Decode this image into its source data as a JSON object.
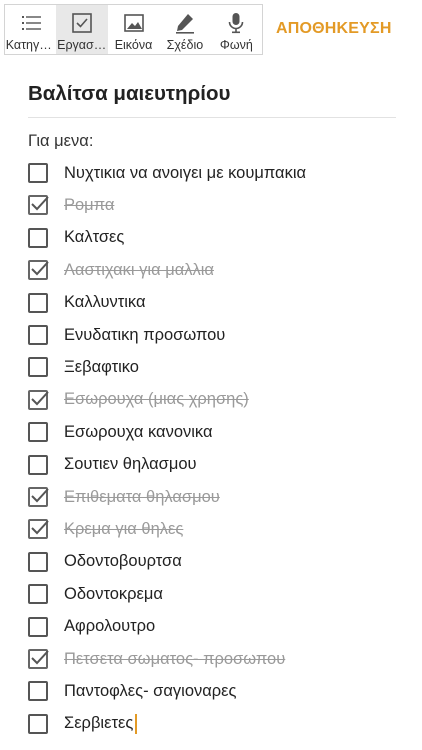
{
  "toolbar": {
    "tools": [
      {
        "label": "Κατηγορία",
        "icon": "list-icon",
        "active": false
      },
      {
        "label": "Εργασίες",
        "icon": "checkbox-icon",
        "active": true
      },
      {
        "label": "Εικόνα",
        "icon": "image-icon",
        "active": false
      },
      {
        "label": "Σχέδιο",
        "icon": "pen-icon",
        "active": false
      },
      {
        "label": "Φωνή",
        "icon": "microphone-icon",
        "active": false
      }
    ],
    "save_label": "ΑΠΟΘΗΚΕΥΣΗ"
  },
  "note": {
    "title": "Βαλίτσα μαιευτηρίου",
    "section_label": "Για μενα:",
    "items": [
      {
        "text": "Νυχτικια να ανοιγει με κουμπακια",
        "checked": false
      },
      {
        "text": "Ρομπα",
        "checked": true
      },
      {
        "text": "Καλτσες",
        "checked": false
      },
      {
        "text": "Λαστιχακι για μαλλια",
        "checked": true
      },
      {
        "text": "Καλλυντικα",
        "checked": false
      },
      {
        "text": "Ενυδατικη προσωπου",
        "checked": false
      },
      {
        "text": "Ξεβαφτικο",
        "checked": false
      },
      {
        "text": "Εσωρουχα (μιας χρησης)",
        "checked": true
      },
      {
        "text": "Εσωρουχα κανονικα",
        "checked": false
      },
      {
        "text": "Σουτιεν θηλασμου",
        "checked": false
      },
      {
        "text": "Επιθεματα θηλασμου",
        "checked": true
      },
      {
        "text": "Κρεμα για θηλες",
        "checked": true
      },
      {
        "text": "Οδοντοβουρτσα",
        "checked": false
      },
      {
        "text": "Οδοντοκρεμα",
        "checked": false
      },
      {
        "text": "Αφρολουτρο",
        "checked": false
      },
      {
        "text": "Πετσετα σωματος- προσωπου",
        "checked": true
      },
      {
        "text": "Παντοφλες- σαγιοναρες",
        "checked": false
      },
      {
        "text": "Σερβιετες",
        "checked": false,
        "editing": true
      }
    ]
  },
  "colors": {
    "accent": "#e39a26",
    "checked_text": "#9a9a9a"
  }
}
